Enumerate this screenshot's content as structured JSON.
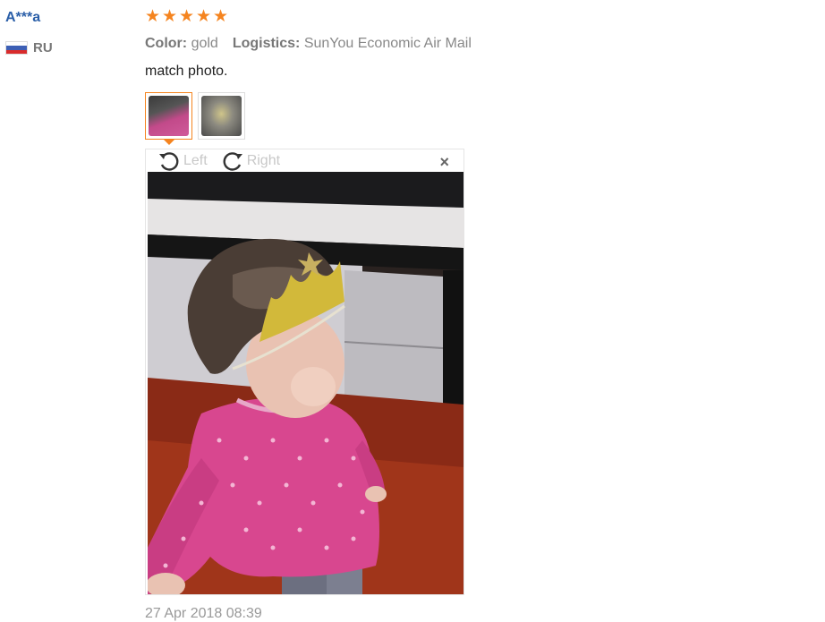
{
  "review": {
    "user_name": "A***a",
    "country_code": "RU",
    "rating": 5,
    "rating_max": 5,
    "color_label": "Color:",
    "color_value": "gold",
    "logistics_label": "Logistics:",
    "logistics_value": "SunYou Economic Air Mail",
    "text": "match photo.",
    "date": "27 Apr 2018 08:39"
  },
  "viewer": {
    "rotate_left_label": "Left",
    "rotate_right_label": "Right",
    "close_glyph": "×"
  },
  "icons": {
    "star": "★",
    "rotate_left": "rotate-left-icon",
    "rotate_right": "rotate-right-icon",
    "close": "close-icon"
  },
  "colors": {
    "accent": "#f5841f",
    "username": "#2b5fa8"
  }
}
